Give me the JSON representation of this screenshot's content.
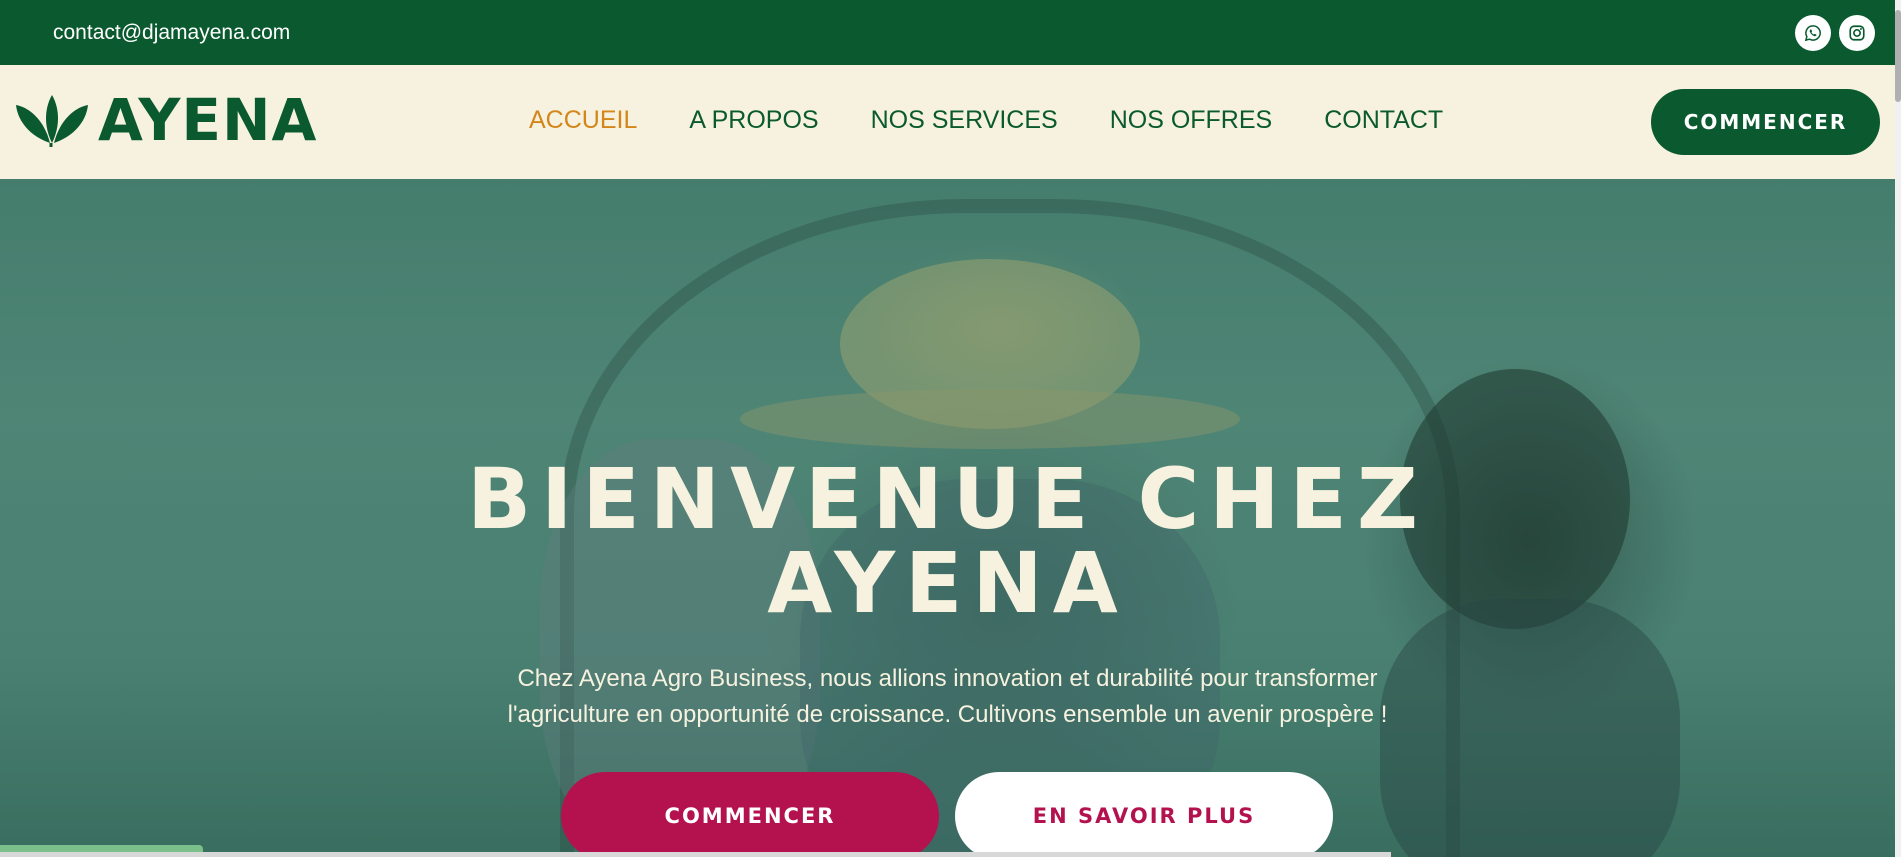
{
  "topbar": {
    "email": "contact@djamayena.com",
    "socials": [
      {
        "icon": "whatsapp-icon"
      },
      {
        "icon": "instagram-icon"
      }
    ]
  },
  "brand": {
    "name": "AYENA",
    "logo_icon": "leaf-logo-icon"
  },
  "nav": {
    "items": [
      {
        "label": "ACCUEIL",
        "active": true
      },
      {
        "label": "A PROPOS",
        "active": false
      },
      {
        "label": "NOS SERVICES",
        "active": false
      },
      {
        "label": "NOS OFFRES",
        "active": false
      },
      {
        "label": "CONTACT",
        "active": false
      }
    ],
    "cta_label": "COMMENCER"
  },
  "hero": {
    "title_line1": "BIENVENUE CHEZ",
    "title_line2": "AYENA",
    "subtitle_line1": "Chez Ayena Agro Business, nous allions innovation et durabilité pour transformer",
    "subtitle_line2": "l'agriculture en opportunité de croissance. Cultivons ensemble un avenir prospère !",
    "primary_button": "COMMENCER",
    "secondary_button": "EN SAVOIR PLUS"
  },
  "colors": {
    "brand_green": "#0b5a2f",
    "cream": "#f6f2df",
    "accent_orange": "#d4861a",
    "accent_magenta": "#b3124f"
  }
}
